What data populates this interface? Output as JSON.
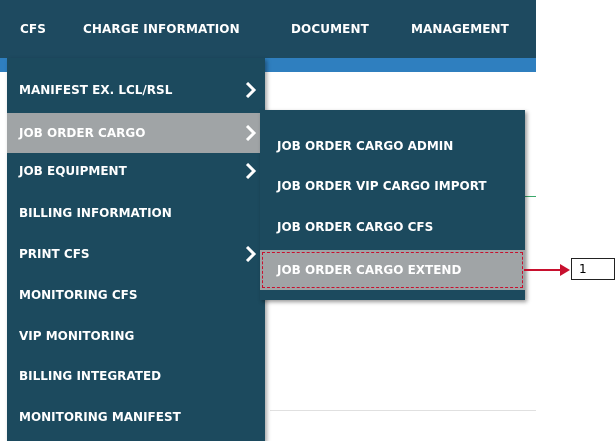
{
  "topnav": {
    "items": [
      {
        "label": "CFS"
      },
      {
        "label": "CHARGE INFORMATION"
      },
      {
        "label": "DOCUMENT"
      },
      {
        "label": "MANAGEMENT"
      }
    ]
  },
  "menu": {
    "items": [
      {
        "label": "MANIFEST EX. LCL/RSL"
      },
      {
        "label": "JOB ORDER CARGO"
      },
      {
        "label": "JOB EQUIPMENT"
      },
      {
        "label": "BILLING INFORMATION"
      },
      {
        "label": "PRINT CFS"
      },
      {
        "label": "MONITORING CFS"
      },
      {
        "label": "VIP MONITORING"
      },
      {
        "label": "BILLING INTEGRATED"
      },
      {
        "label": "MONITORING MANIFEST"
      }
    ]
  },
  "submenu": {
    "items": [
      {
        "label": "JOB ORDER CARGO ADMIN"
      },
      {
        "label": "JOB ORDER VIP CARGO IMPORT"
      },
      {
        "label": "JOB ORDER CARGO CFS"
      },
      {
        "label": "JOB ORDER CARGO EXTEND"
      }
    ]
  },
  "callout": {
    "label": "1"
  },
  "colors": {
    "menu_bg": "#1c4a5e",
    "highlight": "#a0a4a6",
    "callout": "#c8102e",
    "accent": "#2f7fbf"
  }
}
